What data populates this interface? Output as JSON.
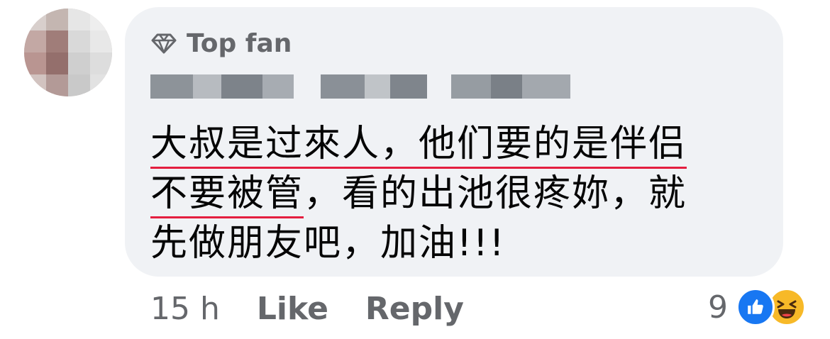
{
  "comment": {
    "badge_label": "Top fan",
    "lines": [
      {
        "underlined": "大叔是过來人，他们要的是伴侣",
        "rest": ""
      },
      {
        "underlined": "不要被管",
        "rest": "，看的出池很疼妳，就"
      },
      {
        "underlined": "",
        "rest": "先做朋友吧，加油!!!"
      }
    ]
  },
  "actions": {
    "time": "15 h",
    "like_label": "Like",
    "reply_label": "Reply"
  },
  "reactions": {
    "count": "9",
    "icons": [
      "like-icon",
      "haha-icon"
    ]
  },
  "colors": {
    "bubble": "#f0f2f5",
    "underline": "#e41e3f",
    "like_blue": "#1877f2",
    "haha_yellow": "#f7b928"
  }
}
